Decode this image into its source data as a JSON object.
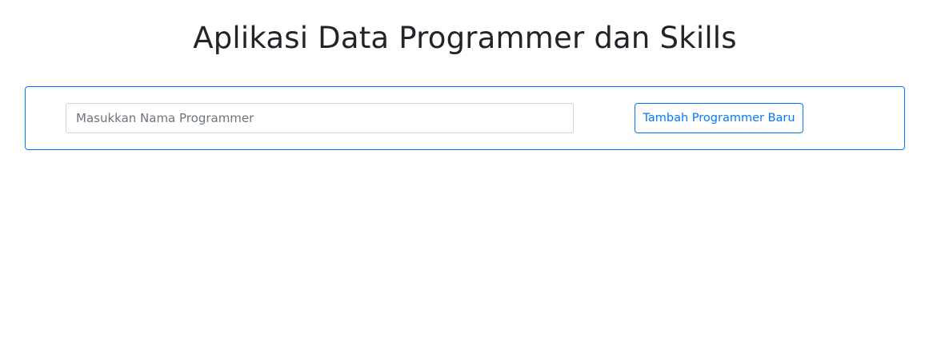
{
  "header": {
    "title": "Aplikasi Data Programmer dan Skills"
  },
  "form": {
    "name_input": {
      "placeholder": "Masukkan Nama Programmer",
      "value": ""
    },
    "add_button_label": "Tambah Programmer Baru"
  },
  "colors": {
    "primary": "#007bff",
    "text": "#212529",
    "input_border": "#ced4da",
    "placeholder": "#6c757d"
  }
}
